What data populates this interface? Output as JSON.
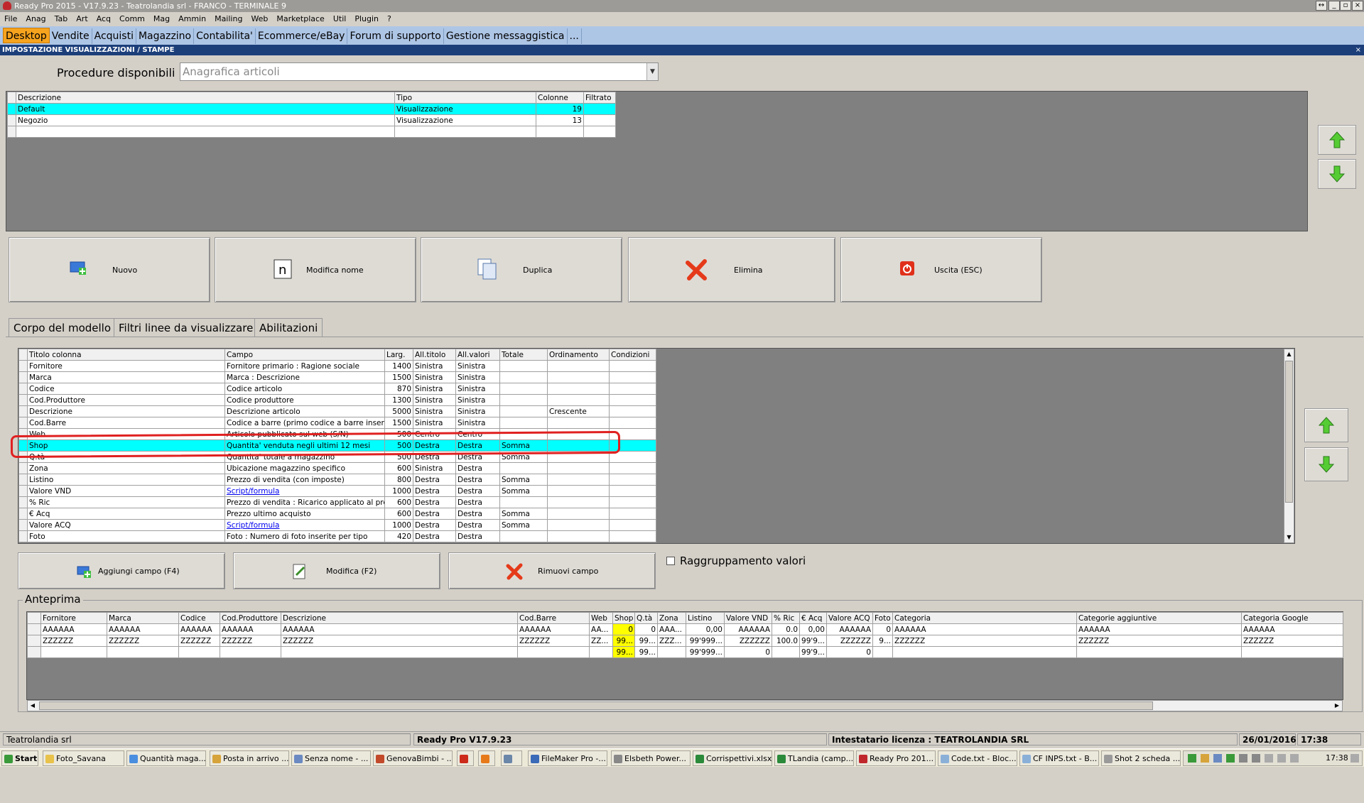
{
  "window": {
    "title": "Ready Pro 2015 - V17.9.23 - Teatrolandia srl - FRANCO - TERMINALE 9"
  },
  "menu": [
    "File",
    "Anag",
    "Tab",
    "Art",
    "Acq",
    "Comm",
    "Mag",
    "Ammin",
    "Mailing",
    "Web",
    "Marketplace",
    "Util",
    "Plugin",
    "?"
  ],
  "nav_tabs": [
    "Desktop",
    "Vendite",
    "Acquisti",
    "Magazzino",
    "Contabilita'",
    "Ecommerce/eBay",
    "Forum di supporto",
    "Gestione messaggistica",
    "..."
  ],
  "section_title": "IMPOSTAZIONE VISUALIZZAZIONI / STAMPE",
  "procedure": {
    "label": "Procedure disponibili :",
    "value": "Anagrafica articoli"
  },
  "models": {
    "headers": [
      "Descrizione",
      "Tipo",
      "Colonne",
      "Filtrato"
    ],
    "rows": [
      [
        "Default",
        "Visualizzazione",
        "19",
        ""
      ],
      [
        "Negozio",
        "Visualizzazione",
        "13",
        ""
      ]
    ]
  },
  "actions": {
    "new": "Nuovo",
    "rename": "Modifica nome",
    "duplicate": "Duplica",
    "delete": "Elimina",
    "exit": "Uscita (ESC)"
  },
  "subtabs": [
    "Corpo del modello",
    "Filtri linee da visualizzare",
    "Abilitazioni"
  ],
  "fields": {
    "headers": [
      "Titolo colonna",
      "Campo",
      "Larg.",
      "All.titolo",
      "All.valori",
      "Totale",
      "Ordinamento",
      "Condizioni"
    ],
    "rows": [
      [
        "Fornitore",
        "Fornitore primario : Ragione sociale",
        "1400",
        "Sinistra",
        "Sinistra",
        "",
        "",
        ""
      ],
      [
        "Marca",
        "Marca : Descrizione",
        "1500",
        "Sinistra",
        "Sinistra",
        "",
        "",
        ""
      ],
      [
        "Codice",
        "Codice articolo",
        "870",
        "Sinistra",
        "Sinistra",
        "",
        "",
        ""
      ],
      [
        "Cod.Produttore",
        "Codice produttore",
        "1300",
        "Sinistra",
        "Sinistra",
        "",
        "",
        ""
      ],
      [
        "Descrizione",
        "Descrizione articolo",
        "5000",
        "Sinistra",
        "Sinistra",
        "",
        "Crescente",
        ""
      ],
      [
        "Cod.Barre",
        "Codice a barre (primo codice a barre inserito)",
        "1500",
        "Sinistra",
        "Sinistra",
        "",
        "",
        ""
      ],
      [
        "Web",
        "Articolo pubblicato sul web (S/N)",
        "500",
        "Centro",
        "Centro",
        "",
        "",
        ""
      ],
      [
        "Shop",
        "Quantita' venduta negli ultimi 12 mesi",
        "500",
        "Destra",
        "Destra",
        "Somma",
        "",
        ""
      ],
      [
        "Q.tà",
        "Quantita' totale a magazzino",
        "500",
        "Destra",
        "Destra",
        "Somma",
        "",
        ""
      ],
      [
        "Zona",
        "Ubicazione magazzino specifico",
        "600",
        "Sinistra",
        "Destra",
        "",
        "",
        ""
      ],
      [
        "Listino",
        "Prezzo di vendita (con imposte)",
        "800",
        "Destra",
        "Destra",
        "Somma",
        "",
        ""
      ],
      [
        "Valore VND",
        "Script/formula",
        "1000",
        "Destra",
        "Destra",
        "Somma",
        "",
        ""
      ],
      [
        "% Ric",
        "Prezzo di vendita : Ricarico applicato al pre...",
        "600",
        "Destra",
        "Destra",
        "",
        "",
        ""
      ],
      [
        "€ Acq",
        "Prezzo ultimo acquisto",
        "600",
        "Destra",
        "Destra",
        "Somma",
        "",
        ""
      ],
      [
        "Valore ACQ",
        "Script/formula",
        "1000",
        "Destra",
        "Destra",
        "Somma",
        "",
        ""
      ],
      [
        "Foto",
        "Foto : Numero di foto inserite per tipo",
        "420",
        "Destra",
        "Destra",
        "",
        "",
        ""
      ]
    ]
  },
  "field_actions": {
    "add": "Aggiungi campo (F4)",
    "edit": "Modifica (F2)",
    "remove": "Rimuovi campo"
  },
  "grouping": {
    "label": "Raggruppamento valori",
    "checked": false
  },
  "preview": {
    "title": "Anteprima",
    "headers": [
      "Fornitore",
      "Marca",
      "Codice",
      "Cod.Produttore",
      "Descrizione",
      "Cod.Barre",
      "Web",
      "Shop",
      "Q.tà",
      "Zona",
      "Listino",
      "Valore VND",
      "% Ric",
      "€ Acq",
      "Valore ACQ",
      "Foto",
      "Categoria",
      "Categorie aggiuntive",
      "Categoria Google"
    ],
    "rows": [
      [
        "AAAAAA",
        "AAAAAA",
        "AAAAAA",
        "AAAAAA",
        "AAAAAA",
        "AAAAAA",
        "AA...",
        "0",
        "0",
        "AAA...",
        "0,00",
        "AAAAAA",
        "0.0",
        "0,00",
        "AAAAAA",
        "0",
        "AAAAAA",
        "AAAAAA",
        "AAAAAA"
      ],
      [
        "ZZZZZZ",
        "ZZZZZZ",
        "ZZZZZZ",
        "ZZZZZZ",
        "ZZZZZZ",
        "ZZZZZZ",
        "ZZ...",
        "99...",
        "99...",
        "ZZZ...",
        "99'999...",
        "ZZZZZZ",
        "100.0",
        "99'9...",
        "ZZZZZZ",
        "9...",
        "ZZZZZZ",
        "ZZZZZZ",
        "ZZZZZZ"
      ],
      [
        "",
        "",
        "",
        "",
        "",
        "",
        "",
        "99...",
        "99...",
        "",
        "99'999...",
        "0",
        "",
        "99'9...",
        "0",
        "",
        "",
        "",
        ""
      ]
    ]
  },
  "status": {
    "company": "Teatrolandia srl",
    "version": "Ready Pro V17.9.23",
    "license": "Intestatario licenza : TEATROLANDIA SRL",
    "date": "26/01/2016",
    "time": "17:38"
  },
  "taskbar": {
    "start": "Start",
    "items": [
      "Foto_Savana",
      "Quantità maga...",
      "Posta in arrivo ...",
      "Senza nome - ...",
      "GenovaBimbi - ...",
      "",
      "",
      "",
      "FileMaker Pro -...",
      "Elsbeth Power...",
      "Corrispettivi.xlsx",
      "TLandia (camp...",
      "Ready Pro 201...",
      "Code.txt - Bloc...",
      "CF INPS.txt - B...",
      "Shot 2 scheda ..."
    ],
    "clock": "17:38"
  },
  "colors": {
    "selection": "#00ffff",
    "nav_active": "#f6a31e",
    "highlight": "#ffff00",
    "annotation": "#e02020"
  }
}
